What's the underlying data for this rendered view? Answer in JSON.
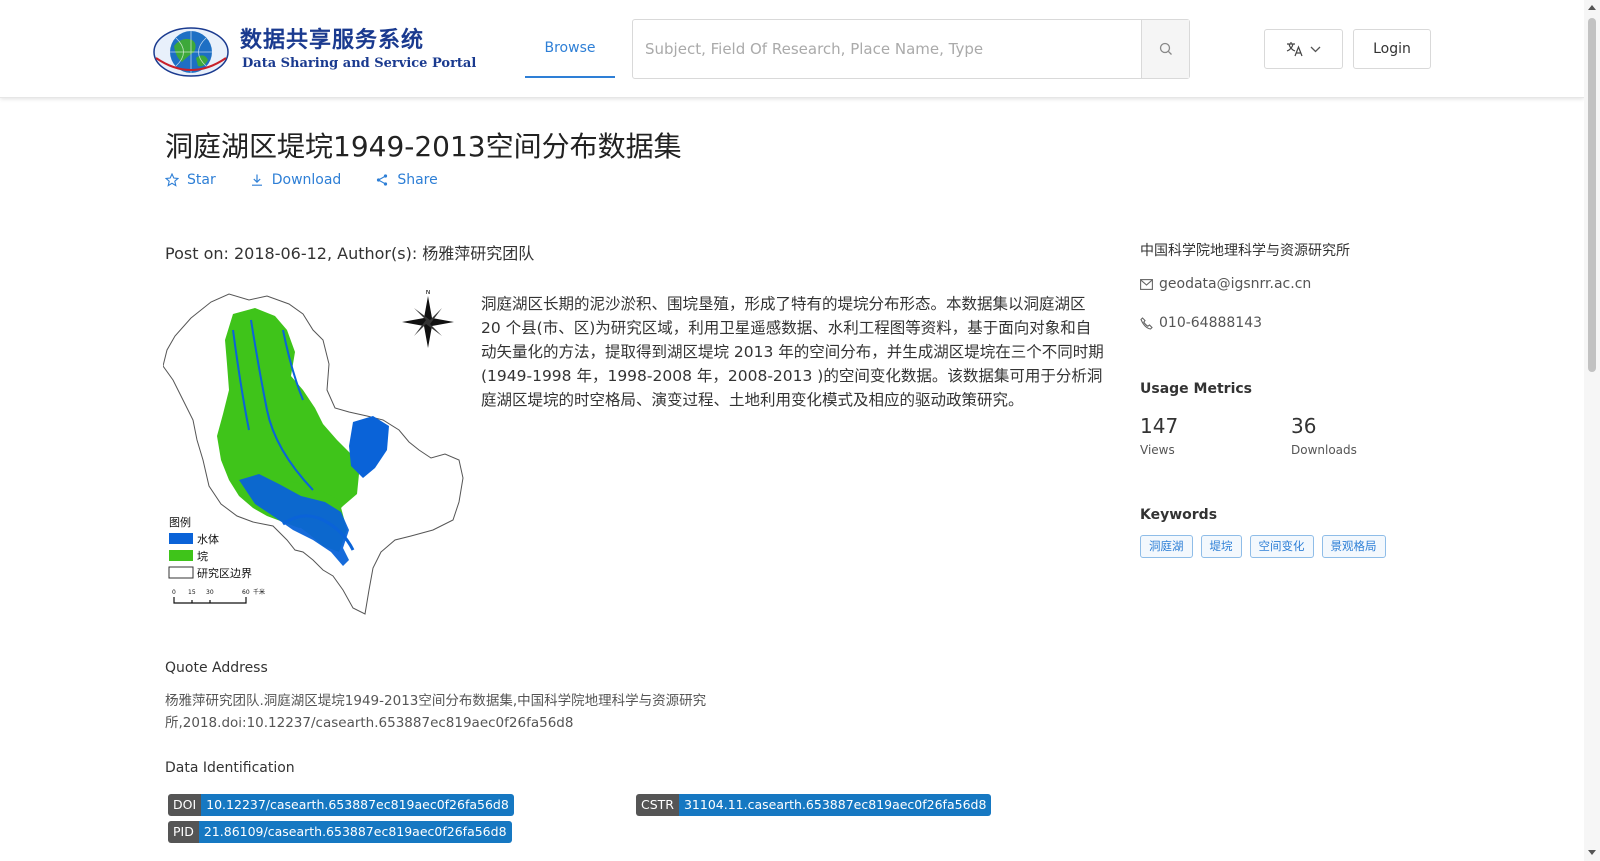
{
  "header": {
    "logo_cn": "数据共享服务系统",
    "logo_en": "Data Sharing and Service Portal",
    "logo_ring_text": "地球大数据科学数据中心",
    "nav_browse": "Browse",
    "search_placeholder": "Subject, Field Of Research, Place Name, Type",
    "search_icon": "search-icon",
    "lang_icon": "translate-icon",
    "login": "Login"
  },
  "dataset": {
    "title": "洞庭湖区堤垸1949-2013空间分布数据集",
    "actions": {
      "star": "Star",
      "download": "Download",
      "share": "Share"
    },
    "post_on": "Post on: 2018-06-12, Author(s): 杨雅萍研究团队",
    "description": "洞庭湖区长期的泥沙淤积、围垸垦殖，形成了特有的堤垸分布形态。本数据集以洞庭湖区 20 个县(市、区)为研究区域，利用卫星遥感数据、水利工程图等资料，基于面向对象和自动矢量化的方法，提取得到湖区堤垸 2013 年的空间分布，并生成湖区堤垸在三个不同时期(1949-1998 年，1998-2008 年，2008-2013 )的空间变化数据。该数据集可用于分析洞庭湖区堤垸的时空格局、演变过程、土地利用变化模式及相应的驱动政策研究。",
    "map": {
      "legend_title": "图例",
      "legend_water": "水体",
      "legend_polder": "垸",
      "legend_boundary": "研究区边界",
      "scale": [
        "0",
        "15",
        "30",
        "60"
      ],
      "scale_unit": "千米",
      "compass_n": "N",
      "colors": {
        "water": "#0a63d8",
        "polder": "#3fc41a",
        "land": "#ffffff"
      }
    },
    "quote_header": "Quote Address",
    "quote_text": "杨雅萍研究团队.洞庭湖区堤垸1949-2013空间分布数据集,中国科学院地理科学与资源研究所,2018.doi:10.12237/casearth.653887ec819aec0f26fa56d8",
    "ident_header": "Data Identification",
    "identifiers": {
      "doi_key": "DOI",
      "doi_val": "10.12237/casearth.653887ec819aec0f26fa56d8",
      "cstr_key": "CSTR",
      "cstr_val": "31104.11.casearth.653887ec819aec0f26fa56d8",
      "pid_key": "PID",
      "pid_val": "21.86109/casearth.653887ec819aec0f26fa56d8"
    }
  },
  "sidebar": {
    "org": "中国科学院地理科学与资源研究所",
    "email": "geodata@igsnrr.ac.cn",
    "phone": "010-64888143",
    "usage_header": "Usage Metrics",
    "views_value": "147",
    "views_label": "Views",
    "downloads_value": "36",
    "downloads_label": "Downloads",
    "keywords_header": "Keywords",
    "keywords": [
      "洞庭湖",
      "堤垸",
      "空间变化",
      "景观格局"
    ]
  },
  "colors": {
    "accent": "#2e7fd6",
    "tag_blue": "#1678c2",
    "tag_gray": "#555555"
  }
}
